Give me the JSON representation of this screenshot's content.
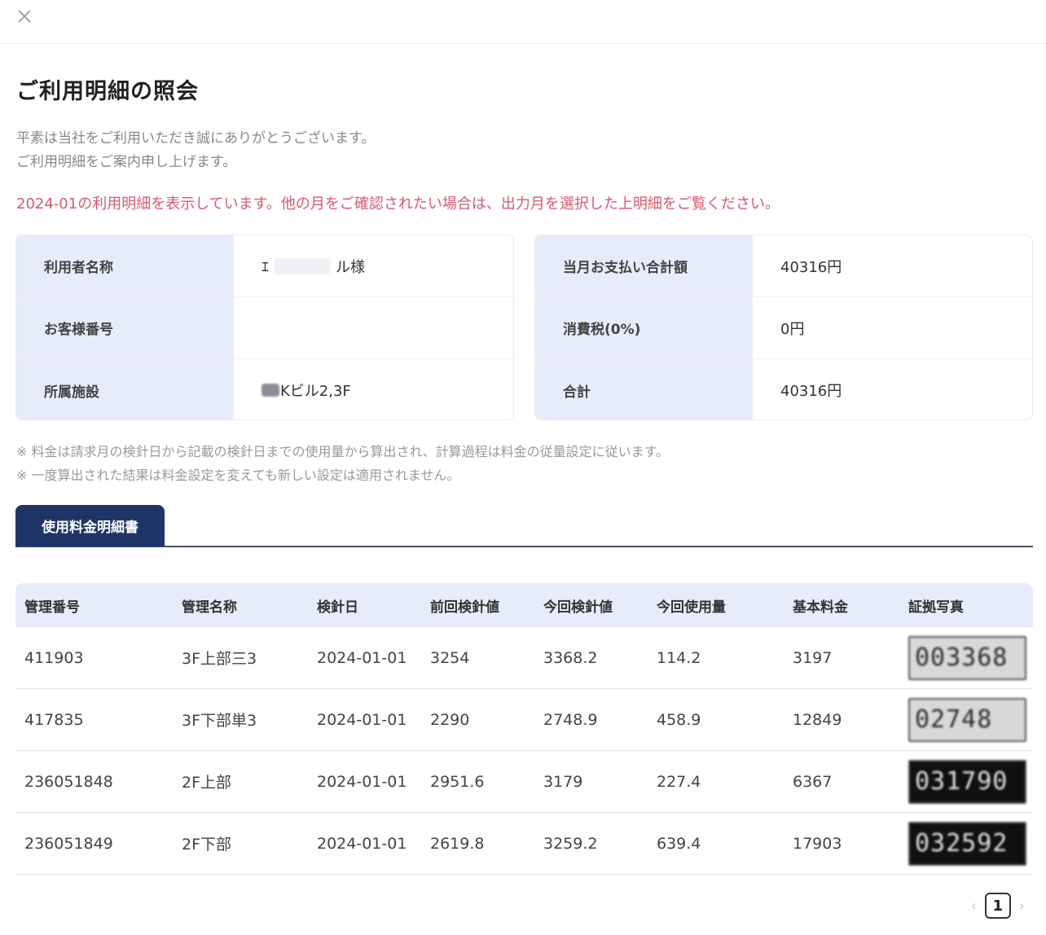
{
  "header": {
    "close_icon": "close-icon"
  },
  "title": "ご利用明細の照会",
  "intro": {
    "line1": "平素は当社をご利用いただき誠にありがとうございます。",
    "line2": "ご利用明細をご案内申し上げます。"
  },
  "notice": {
    "text": "2024-01の利用明細を表示しています。他の月をご確認されたい場合は、出力月を選択した上明細をご覧ください。",
    "color": "#d9596e"
  },
  "user_info": {
    "name_label": "利用者名称",
    "name_prefix": "ｴ",
    "name_suffix": "ル様",
    "customer_no_label": "お客様番号",
    "customer_no_value": "",
    "facility_label": "所属施設",
    "facility_value": "Kビル2,3F"
  },
  "billing": {
    "total_label": "当月お支払い合計額",
    "total_value": "40316円",
    "tax_label": "消費税(0%)",
    "tax_value": "0円",
    "sum_label": "合計",
    "sum_value": "40316円"
  },
  "notes": {
    "line1": "※ 料金は請求月の検針日から記載の検針日までの使用量から算出され、計算過程は料金の従量設定に従います。",
    "line2": "※ 一度算出された結果は料金設定を変えても新しい設定は適用されません。"
  },
  "tabs": {
    "active_label": "使用料金明細書",
    "active_color": "#1f3567"
  },
  "table": {
    "headers": [
      "管理番号",
      "管理名称",
      "検針日",
      "前回検針値",
      "今回検針値",
      "今回使用量",
      "基本料金",
      "証拠写真"
    ],
    "rows": [
      {
        "id": "411903",
        "name": "3F上部三3",
        "date": "2024-01-01",
        "prev": "3254",
        "curr": "3368.2",
        "usage": "114.2",
        "fee": "3197",
        "photo": "003368",
        "photo_style": "light"
      },
      {
        "id": "417835",
        "name": "3F下部単3",
        "date": "2024-01-01",
        "prev": "2290",
        "curr": "2748.9",
        "usage": "458.9",
        "fee": "12849",
        "photo": "02748",
        "photo_style": "light"
      },
      {
        "id": "236051848",
        "name": "2F上部",
        "date": "2024-01-01",
        "prev": "2951.6",
        "curr": "3179",
        "usage": "227.4",
        "fee": "6367",
        "photo": "031790",
        "photo_style": "dark"
      },
      {
        "id": "236051849",
        "name": "2F下部",
        "date": "2024-01-01",
        "prev": "2619.8",
        "curr": "3259.2",
        "usage": "639.4",
        "fee": "17903",
        "photo": "032592",
        "photo_style": "dark"
      }
    ]
  },
  "pagination": {
    "prev": "‹",
    "current": "1",
    "next": "›"
  },
  "colors": {
    "label_bg": "#e7ecfb",
    "header_bg": "#e7ecfb",
    "accent": "#1f3567"
  }
}
